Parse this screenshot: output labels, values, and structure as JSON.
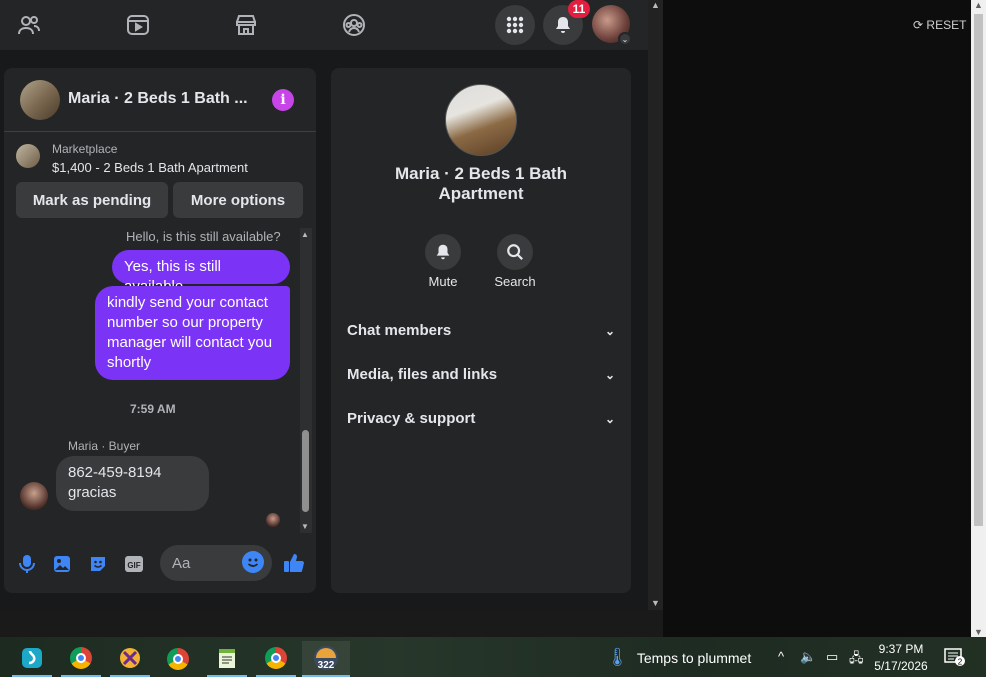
{
  "colors": {
    "accent": "#7b33f5",
    "messenger_blue": "#3e86f5",
    "info_purple": "#c744e8",
    "badge_red": "#e41e3f"
  },
  "topnav": {
    "icons": [
      "friends-icon",
      "watch-icon",
      "marketplace-icon",
      "groups-icon"
    ],
    "notifications_count": "11"
  },
  "chat": {
    "header_title": "Maria · 2 Beds 1 Bath ...",
    "marketplace_label": "Marketplace",
    "listing_title": "$1,400 - 2 Beds 1 Bath Apartment",
    "mark_pending_label": "Mark as pending",
    "more_options_label": "More options",
    "messages": {
      "top_partial": "Hello, is this still available?",
      "out1": "Yes, this is still available",
      "out2": "kindly send your contact number so our property manager will contact you shortly",
      "time": "7:59 AM",
      "sender": "Maria · Buyer",
      "in_line1": "862-459-8194",
      "in_line2": "gracias"
    },
    "input_placeholder": "Aa"
  },
  "info": {
    "name": "Maria · 2 Beds 1 Bath Apartment",
    "mute_label": "Mute",
    "search_label": "Search",
    "sections": [
      "Chat members",
      "Media, files and links",
      "Privacy & support"
    ]
  },
  "right": {
    "reset_label": "RESET"
  },
  "taskbar": {
    "weather_text": "Temps to plummet",
    "time": "9:37 PM",
    "date": "5/17/2026",
    "app_badge": "322",
    "notif_count": "2"
  }
}
